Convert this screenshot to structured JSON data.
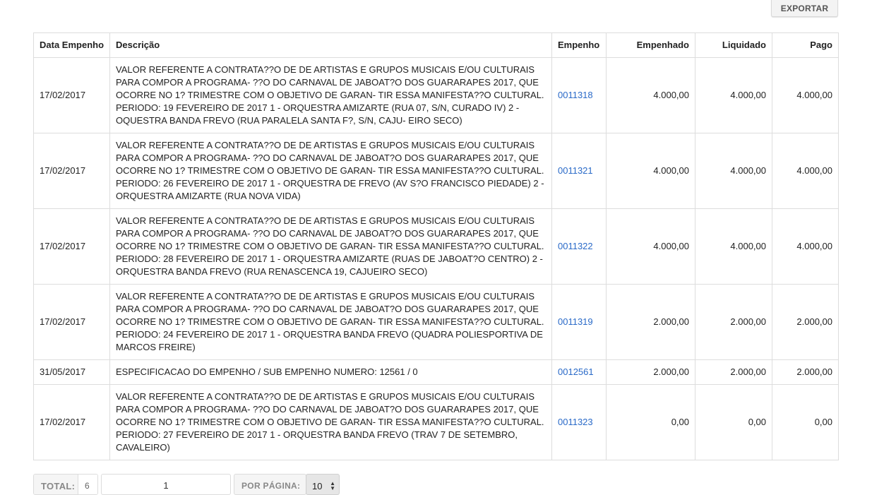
{
  "toolbar": {
    "export_label": "EXPORTAR"
  },
  "table": {
    "headers": {
      "date": "Data Empenho",
      "description": "Descrição",
      "empenho": "Empenho",
      "empenhado": "Empenhado",
      "liquidado": "Liquidado",
      "pago": "Pago"
    },
    "rows": [
      {
        "date": "17/02/2017",
        "description": "VALOR REFERENTE A CONTRATA??O DE DE ARTISTAS E GRUPOS MUSICAIS E/OU CULTURAIS PARA COMPOR A PROGRAMA- ??O DO CARNAVAL DE JABOAT?O DOS GUARARAPES 2017, QUE OCORRE NO 1? TRIMESTRE COM O OBJETIVO DE GARAN- TIR ESSA MANIFESTA??O CULTURAL. PERIODO: 19 FEVEREIRO DE 2017 1 - ORQUESTRA AMIZARTE (RUA 07, S/N, CURADO IV) 2 - OQUESTRA BANDA FREVO (RUA PARALELA SANTA F?, S/N, CAJU- EIRO SECO)",
        "empenho": "0011318",
        "empenhado": "4.000,00",
        "liquidado": "4.000,00",
        "pago": "4.000,00"
      },
      {
        "date": "17/02/2017",
        "description": "VALOR REFERENTE A CONTRATA??O DE DE ARTISTAS E GRUPOS MUSICAIS E/OU CULTURAIS PARA COMPOR A PROGRAMA- ??O DO CARNAVAL DE JABOAT?O DOS GUARARAPES 2017, QUE OCORRE NO 1? TRIMESTRE COM O OBJETIVO DE GARAN- TIR ESSA MANIFESTA??O CULTURAL. PERIODO: 26 FEVEREIRO DE 2017 1 - ORQUESTRA DE FREVO (AV S?O FRANCISCO PIEDADE) 2 - ORQUESTRA AMIZARTE (RUA NOVA VIDA)",
        "empenho": "0011321",
        "empenhado": "4.000,00",
        "liquidado": "4.000,00",
        "pago": "4.000,00"
      },
      {
        "date": "17/02/2017",
        "description": "VALOR REFERENTE A CONTRATA??O DE DE ARTISTAS E GRUPOS MUSICAIS E/OU CULTURAIS PARA COMPOR A PROGRAMA- ??O DO CARNAVAL DE JABOAT?O DOS GUARARAPES 2017, QUE OCORRE NO 1? TRIMESTRE COM O OBJETIVO DE GARAN- TIR ESSA MANIFESTA??O CULTURAL. PERIODO: 28 FEVEREIRO DE 2017 1 - ORQUESTRA AMIZARTE (RUAS DE JABOAT?O CENTRO) 2 - ORQUESTRA BANDA FREVO (RUA RENASCENCA 19, CAJUEIRO SECO)",
        "empenho": "0011322",
        "empenhado": "4.000,00",
        "liquidado": "4.000,00",
        "pago": "4.000,00"
      },
      {
        "date": "17/02/2017",
        "description": "VALOR REFERENTE A CONTRATA??O DE DE ARTISTAS E GRUPOS MUSICAIS E/OU CULTURAIS PARA COMPOR A PROGRAMA- ??O DO CARNAVAL DE JABOAT?O DOS GUARARAPES 2017, QUE OCORRE NO 1? TRIMESTRE COM O OBJETIVO DE GARAN- TIR ESSA MANIFESTA??O CULTURAL. PERIODO: 24 FEVEREIRO DE 2017 1 - ORQUESTRA BANDA FREVO (QUADRA POLIESPORTIVA DE MARCOS FREIRE)",
        "empenho": "0011319",
        "empenhado": "2.000,00",
        "liquidado": "2.000,00",
        "pago": "2.000,00"
      },
      {
        "date": "31/05/2017",
        "description": "ESPECIFICACAO DO EMPENHO / SUB EMPENHO NUMERO: 12561 / 0",
        "empenho": "0012561",
        "empenhado": "2.000,00",
        "liquidado": "2.000,00",
        "pago": "2.000,00"
      },
      {
        "date": "17/02/2017",
        "description": "VALOR REFERENTE A CONTRATA??O DE DE ARTISTAS E GRUPOS MUSICAIS E/OU CULTURAIS PARA COMPOR A PROGRAMA- ??O DO CARNAVAL DE JABOAT?O DOS GUARARAPES 2017, QUE OCORRE NO 1? TRIMESTRE COM O OBJETIVO DE GARAN- TIR ESSA MANIFESTA??O CULTURAL. PERIODO: 27 FEVEREIRO DE 2017 1 - ORQUESTRA BANDA FREVO (TRAV 7 DE SETEMBRO, CAVALEIRO)",
        "empenho": "0011323",
        "empenhado": "0,00",
        "liquidado": "0,00",
        "pago": "0,00"
      }
    ]
  },
  "pagination": {
    "total_label": "TOTAL:",
    "total_value": "6",
    "page_value": "1",
    "per_page_label": "POR PÁGINA:",
    "per_page_value": "10"
  },
  "icons": {
    "select_arrows": "up-down-chevron-icon"
  },
  "colors": {
    "link": "#2a6ac8",
    "border": "#dddddd",
    "button_bg": "#f3f3f3"
  }
}
